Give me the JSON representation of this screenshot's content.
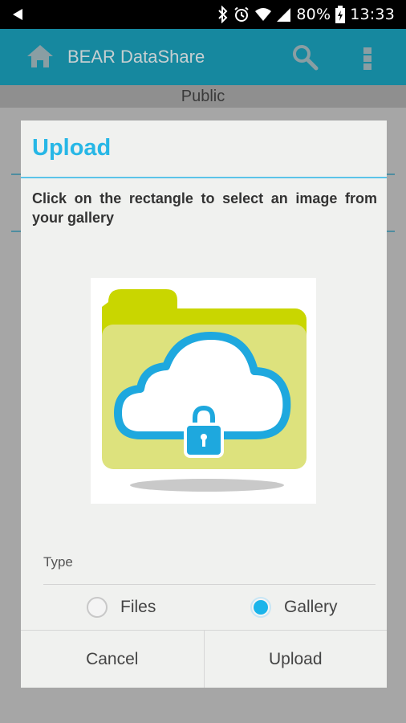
{
  "status_bar": {
    "battery_text": "80%",
    "time": "13:33"
  },
  "app_bar": {
    "title": "BEAR DataShare",
    "color": "#16889f"
  },
  "sub_header": {
    "label": "Public"
  },
  "dialog": {
    "title": "Upload",
    "instruction": "Click on the rectangle to select an image from your gallery",
    "type_label": "Type",
    "options": [
      {
        "label": "Files",
        "selected": false
      },
      {
        "label": "Gallery",
        "selected": true
      }
    ],
    "cancel_label": "Cancel",
    "upload_label": "Upload",
    "accent_color": "#27b7e6"
  },
  "icons": [
    "back-arrow-icon",
    "bluetooth-icon",
    "alarm-icon",
    "wifi-icon",
    "signal-icon",
    "battery-icon",
    "home-icon",
    "search-icon",
    "overflow-menu-icon",
    "cloud-folder-lock-icon"
  ]
}
